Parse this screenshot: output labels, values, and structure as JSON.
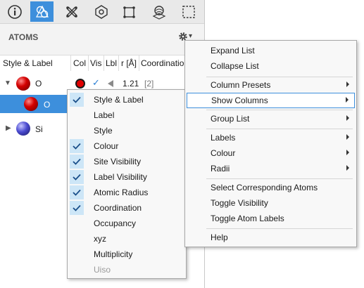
{
  "toolbar": {
    "buttons": [
      {
        "icon": "info-icon"
      },
      {
        "icon": "atoms-structure-icon",
        "active": true
      },
      {
        "icon": "bonds-icon"
      },
      {
        "icon": "polyhedra-icon"
      },
      {
        "icon": "unit-cell-icon"
      },
      {
        "icon": "surface-icon"
      },
      {
        "icon": "boundary-icon"
      }
    ]
  },
  "panel": {
    "title": "ATOMS",
    "gear_caret": "▾"
  },
  "columns": {
    "style_label": "Style & Label",
    "col": "Col",
    "vis": "Vis",
    "lbl": "Lbl",
    "radius": "r [Å]",
    "coordination": "Coordination"
  },
  "tree": [
    {
      "label": "O",
      "radius": "1.21",
      "coord": "[2]",
      "colour": "#e00000"
    },
    {
      "label": "O"
    },
    {
      "label": "Si"
    }
  ],
  "vis_check": "✓",
  "columns_menu": [
    {
      "label": "Style & Label",
      "checked": true,
      "disabled": false
    },
    {
      "label": "Label",
      "checked": false,
      "disabled": false
    },
    {
      "label": "Style",
      "checked": false,
      "disabled": false
    },
    {
      "label": "Colour",
      "checked": true,
      "disabled": false
    },
    {
      "label": "Site Visibility",
      "checked": true,
      "disabled": false
    },
    {
      "label": "Label Visibility",
      "checked": true,
      "disabled": false
    },
    {
      "label": "Atomic Radius",
      "checked": true,
      "disabled": false
    },
    {
      "label": "Coordination",
      "checked": true,
      "disabled": false
    },
    {
      "label": "Occupancy",
      "checked": false,
      "disabled": false
    },
    {
      "label": "xyz",
      "checked": false,
      "disabled": false
    },
    {
      "label": "Multiplicity",
      "checked": false,
      "disabled": false
    },
    {
      "label": "Uiso",
      "checked": false,
      "disabled": true
    }
  ],
  "context_menu": {
    "expand_list": "Expand List",
    "collapse_list": "Collapse List",
    "column_presets": "Column Presets",
    "show_columns": "Show Columns",
    "group_list": "Group List",
    "labels": "Labels",
    "colour": "Colour",
    "radii": "Radii",
    "select_corresponding": "Select Corresponding Atoms",
    "toggle_visibility": "Toggle Visibility",
    "toggle_atom_labels": "Toggle Atom Labels",
    "help": "Help"
  },
  "colors": {
    "accent": "#3d8fdc",
    "check_bg": "#cde6f7"
  }
}
